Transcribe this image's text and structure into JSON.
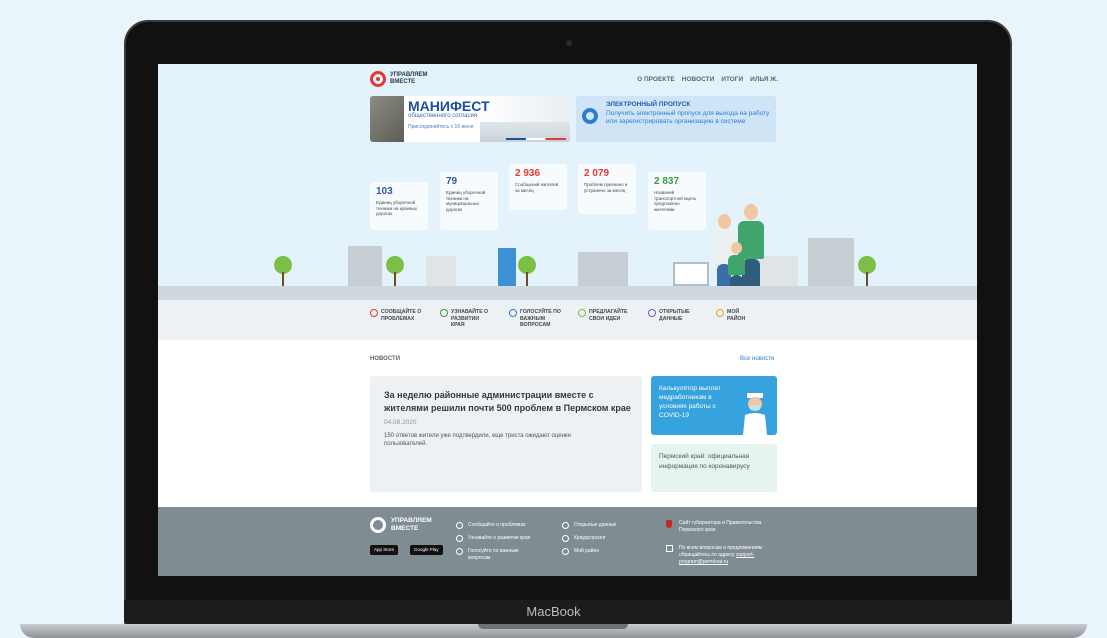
{
  "device": {
    "brand": "MacBook"
  },
  "header": {
    "logo_text": "УПРАВЛЯЕМ ВМЕСТЕ",
    "nav": [
      "О ПРОЕКТЕ",
      "НОВОСТИ",
      "ИТОГИ",
      "ИЛЬЯ Ж."
    ]
  },
  "banners": {
    "manifest": {
      "title": "МАНИФЕСТ",
      "subtitle": "общественного согласия",
      "join": "Присоединяйтесь с 16 июня"
    },
    "pass": {
      "title": "ЭЛЕКТРОННЫЙ ПРОПУСК",
      "text": "Получить электронный пропуск для выхода на работу или зарегистрировать организацию в системе"
    }
  },
  "stats": [
    {
      "value": "103",
      "label": "Единиц уборочной техники на краевых дорогах",
      "color": "#2c5aa0"
    },
    {
      "value": "79",
      "label": "Единиц уборочной техники на муниципальных дорогах",
      "color": "#2c5aa0"
    },
    {
      "value": "2 936",
      "label": "Сообщений жителей за месяц",
      "color": "#e53935"
    },
    {
      "value": "2 079",
      "label": "Проблем признано и устранено за месяц",
      "color": "#e53935"
    },
    {
      "value": "2 837",
      "label": "Названий транспортной карты предложено жителями",
      "color": "#3a9c3f"
    }
  ],
  "actions": [
    {
      "label": "СООБЩАЙТЕ О ПРОБЛЕМАХ",
      "icon": "alert-icon",
      "color": "#e53935"
    },
    {
      "label": "УЗНАВАЙТЕ О РАЗВИТИИ КРАЯ",
      "icon": "map-pin-icon",
      "color": "#3a9c3f"
    },
    {
      "label": "ГОЛОСУЙТЕ ПО ВАЖНЫМ ВОПРОСАМ",
      "icon": "check-circle-icon",
      "color": "#2f7dd1"
    },
    {
      "label": "ПРЕДЛАГАЙТЕ СВОИ ИДЕИ",
      "icon": "lightbulb-icon",
      "color": "#7bbf45"
    },
    {
      "label": "ОТКРЫТЫЕ ДАННЫЕ",
      "icon": "data-icon",
      "color": "#5c6bc0"
    },
    {
      "label": "МОЙ РАЙОН",
      "icon": "location-icon",
      "color": "#f0a020"
    }
  ],
  "news": {
    "heading": "НОВОСТИ",
    "all_link": "Все новости",
    "main": {
      "title": "За неделю районные администрации вместе с жителями решили почти 500 проблем в Пермском крае",
      "date": "04.08.2020",
      "text": "150 ответов жители уже подтвердили, еще триста ожидают оценки пользователей."
    },
    "side_blue": "Калькулятор выплат медработникам в условиях работы с COVID-19",
    "side_green": "Пермский край: официальная информация по коронавирусу"
  },
  "footer": {
    "logo_text": "УПРАВЛЯЕМ ВМЕСТЕ",
    "app_store": "App Store",
    "google_play": "Google Play",
    "col1": [
      "Сообщайте о проблемах",
      "Узнавайте о развитии края",
      "Голосуйте по важным вопросам"
    ],
    "col2": [
      "Открытые данные",
      "Краудсорсинг",
      "Мой район"
    ],
    "gov_site": "Сайт губернатора и Правительства Пермского края",
    "contact_text": "По всем вопросам и предложениям обращайтесь по адресу",
    "contact_email": "support-program@permkrai.ru"
  }
}
